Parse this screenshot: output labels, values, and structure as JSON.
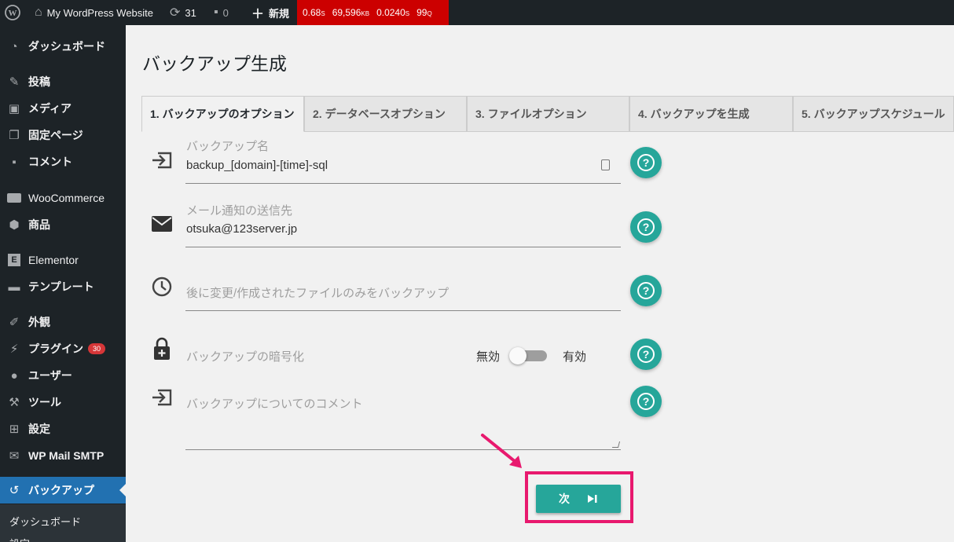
{
  "adminbar": {
    "site_name": "My WordPress Website",
    "updates_count": "31",
    "comments_count": "0",
    "new_label": "新規",
    "qm": {
      "time": "0.68",
      "time_unit": "S",
      "memory": "69,596",
      "memory_unit": "KB",
      "db_time": "0.0240",
      "db_time_unit": "S",
      "queries": "99",
      "queries_unit": "Q"
    },
    "qm_color": "#cc0000"
  },
  "sidebar": {
    "items": [
      {
        "label": "ダッシュボード",
        "icon": "dashboard-icon"
      },
      {
        "label": "投稿",
        "icon": "pin-icon"
      },
      {
        "label": "メディア",
        "icon": "media-icon"
      },
      {
        "label": "固定ページ",
        "icon": "pages-icon"
      },
      {
        "label": "コメント",
        "icon": "comment-icon"
      },
      {
        "label": "WooCommerce",
        "icon": "woo-icon"
      },
      {
        "label": "商品",
        "icon": "box-icon"
      },
      {
        "label": "Elementor",
        "icon": "elementor-icon"
      },
      {
        "label": "テンプレート",
        "icon": "folder-icon"
      },
      {
        "label": "外観",
        "icon": "brush-icon"
      },
      {
        "label": "プラグイン",
        "icon": "plugin-icon",
        "badge": "30"
      },
      {
        "label": "ユーザー",
        "icon": "user-icon"
      },
      {
        "label": "ツール",
        "icon": "wrench-icon"
      },
      {
        "label": "設定",
        "icon": "settings-icon"
      },
      {
        "label": "WP Mail SMTP",
        "icon": "mail-icon"
      },
      {
        "label": "バックアップ",
        "icon": "backup-icon",
        "active": true
      }
    ],
    "submenu": [
      "ダッシュボード",
      "設定"
    ],
    "active_color": "#2271b1"
  },
  "main": {
    "title": "バックアップ生成",
    "tabs": [
      {
        "label": "1. バックアップのオプション"
      },
      {
        "label": "2. データベースオプション"
      },
      {
        "label": "3. ファイルオプション"
      },
      {
        "label": "4. バックアップを生成"
      },
      {
        "label": "5. バックアップスケジュール"
      }
    ],
    "fields": {
      "backup_name": {
        "label": "バックアップ名",
        "value": "backup_[domain]-[time]-sql"
      },
      "email": {
        "label": "メール通知の送信先",
        "value": "otsuka@123server.jp"
      },
      "modified_only": {
        "placeholder": "後に変更/作成されたファイルのみをバックアップ"
      },
      "encryption": {
        "label": "バックアップの暗号化",
        "off_label": "無効",
        "on_label": "有効",
        "enabled": false
      },
      "comment": {
        "placeholder": "バックアップについてのコメント"
      }
    },
    "next_button": {
      "label": "次"
    },
    "accent_color": "#26a69a",
    "highlight_color": "#e8196e"
  }
}
